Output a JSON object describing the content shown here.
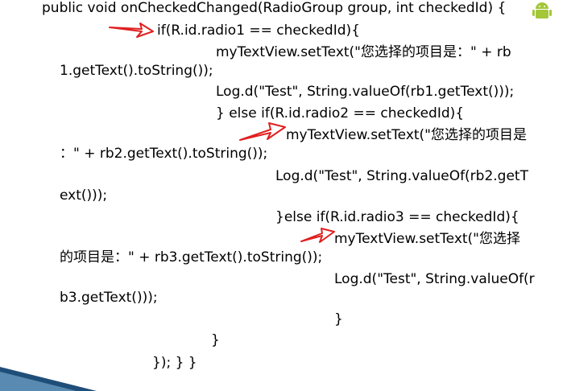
{
  "code_lines": [
    "public void onCheckedChanged(RadioGroup group, int checkedId) {",
    "if(R.id.radio1 == checkedId){",
    "myTextView.setText(\"您选择的项目是：\" + rb",
    "1.getText().toString());",
    "Log.d(\"Test\", String.valueOf(rb1.getText()));",
    "} else if(R.id.radio2 == checkedId){",
    "myTextView.setText(\"您选择的项目是",
    "：\" + rb2.getText().toString());",
    "Log.d(\"Test\", String.valueOf(rb2.getT",
    "ext()));",
    "}else if(R.id.radio3 == checkedId){",
    "myTextView.setText(\"您选择",
    "的项目是：\" + rb3.getText().toString());",
    "Log.d(\"Test\", String.valueOf(r",
    "b3.getText()));",
    "}",
    "}",
    "}); } }"
  ],
  "colors": {
    "arrow": "#e02020",
    "android_green": "#a4c639",
    "swoosh_dark": "#1f4e79",
    "swoosh_light": "#7fb3d9"
  },
  "icons": {
    "arrow": "red-arrow-icon",
    "logo": "android-logo-icon",
    "decoration": "corner-swoosh"
  }
}
